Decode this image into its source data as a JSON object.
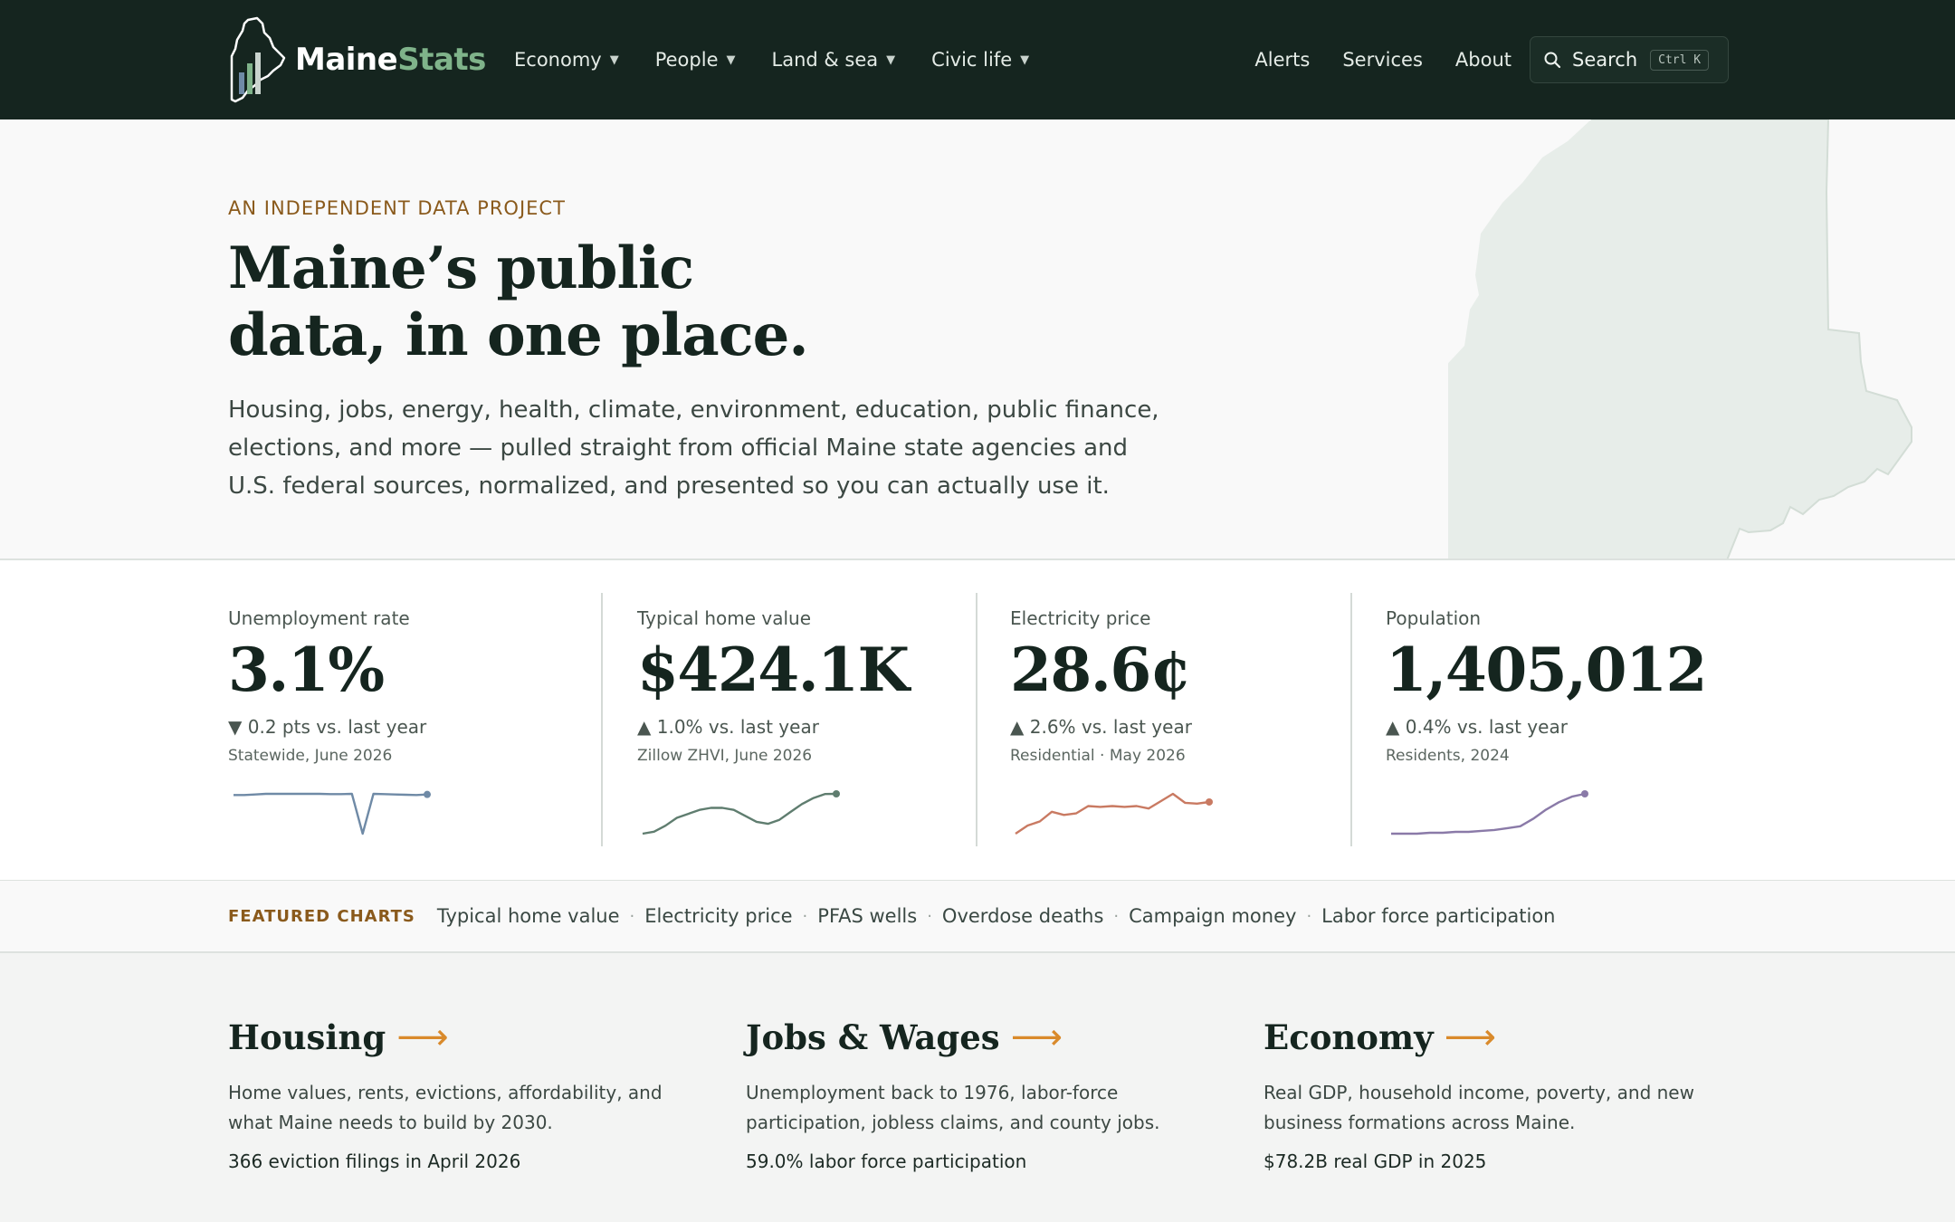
{
  "nav": {
    "logo": {
      "part1": "Maine",
      "part2": "Stats"
    },
    "menu": [
      {
        "label": "Economy"
      },
      {
        "label": "People"
      },
      {
        "label": "Land & sea"
      },
      {
        "label": "Civic life"
      }
    ],
    "links": [
      {
        "label": "Alerts"
      },
      {
        "label": "Services"
      },
      {
        "label": "About"
      }
    ],
    "search": {
      "label": "Search",
      "shortcut": "Ctrl K"
    }
  },
  "hero": {
    "eyebrow": "AN INDEPENDENT DATA PROJECT",
    "title_line1": "Maine’s public",
    "title_line2": "data, in one place.",
    "description": "Housing, jobs, energy, health, climate, environment, education, public finance, elections, and more — pulled straight from official Maine state agencies and U.S. federal sources, normalized, and presented so you can actually use it."
  },
  "stats": [
    {
      "label": "Unemployment rate",
      "value": "3.1%",
      "change": "▼ 0.2 pts vs. last year",
      "source": "Statewide, June 2026",
      "color": "#6f8aa6",
      "sparkline": [
        3.3,
        3.3,
        3.32,
        3.34,
        3.34,
        3.34,
        3.34,
        3.34,
        3.34,
        3.33,
        3.33,
        3.34,
        2.0,
        3.34,
        3.33,
        3.32,
        3.31,
        3.3,
        3.32
      ]
    },
    {
      "label": "Typical home value",
      "value": "$424.1K",
      "change": "▲ 1.0% vs. last year",
      "source": "Zillow ZHVI, June 2026",
      "color": "#5f7d6f",
      "sparkline": [
        404,
        405,
        408,
        412,
        414,
        416,
        417,
        417,
        416,
        413,
        410,
        409,
        411,
        415,
        419,
        422,
        424,
        424.1
      ]
    },
    {
      "label": "Electricity price",
      "value": "28.6¢",
      "change": "▲ 2.6% vs. last year",
      "source": "Residential · May 2026",
      "color": "#c97a62",
      "sparkline": [
        24.5,
        25.5,
        26.0,
        27.2,
        26.8,
        27.0,
        27.9,
        27.8,
        27.9,
        27.8,
        27.9,
        27.6,
        28.5,
        29.4,
        28.3,
        28.2,
        28.4
      ]
    },
    {
      "label": "Population",
      "value": "1,405,012",
      "change": "▲ 0.4% vs. last year",
      "source": "Residents, 2024",
      "color": "#8a7aa8",
      "sparkline": [
        1362,
        1362,
        1362,
        1363,
        1363,
        1364,
        1364,
        1365,
        1366,
        1368,
        1370,
        1378,
        1388,
        1396,
        1402,
        1405
      ]
    }
  ],
  "featured": {
    "label": "FEATURED CHARTS",
    "links": [
      "Typical home value",
      "Electricity price",
      "PFAS wells",
      "Overdose deaths",
      "Campaign money",
      "Labor force participation"
    ]
  },
  "categories": [
    {
      "title": "Housing",
      "arrow": "⟶",
      "description": "Home values, rents, evictions, affordability, and what Maine needs to build by 2030.",
      "stat": "366 eviction filings in April 2026"
    },
    {
      "title": "Jobs & Wages",
      "arrow": "⟶",
      "description": "Unemployment back to 1976, labor-force participation, jobless claims, and county jobs.",
      "stat": "59.0% labor force participation"
    },
    {
      "title": "Economy",
      "arrow": "⟶",
      "description": "Real GDP, household income, poverty, and new business formations across Maine.",
      "stat": "$78.2B real GDP in 2025"
    }
  ]
}
